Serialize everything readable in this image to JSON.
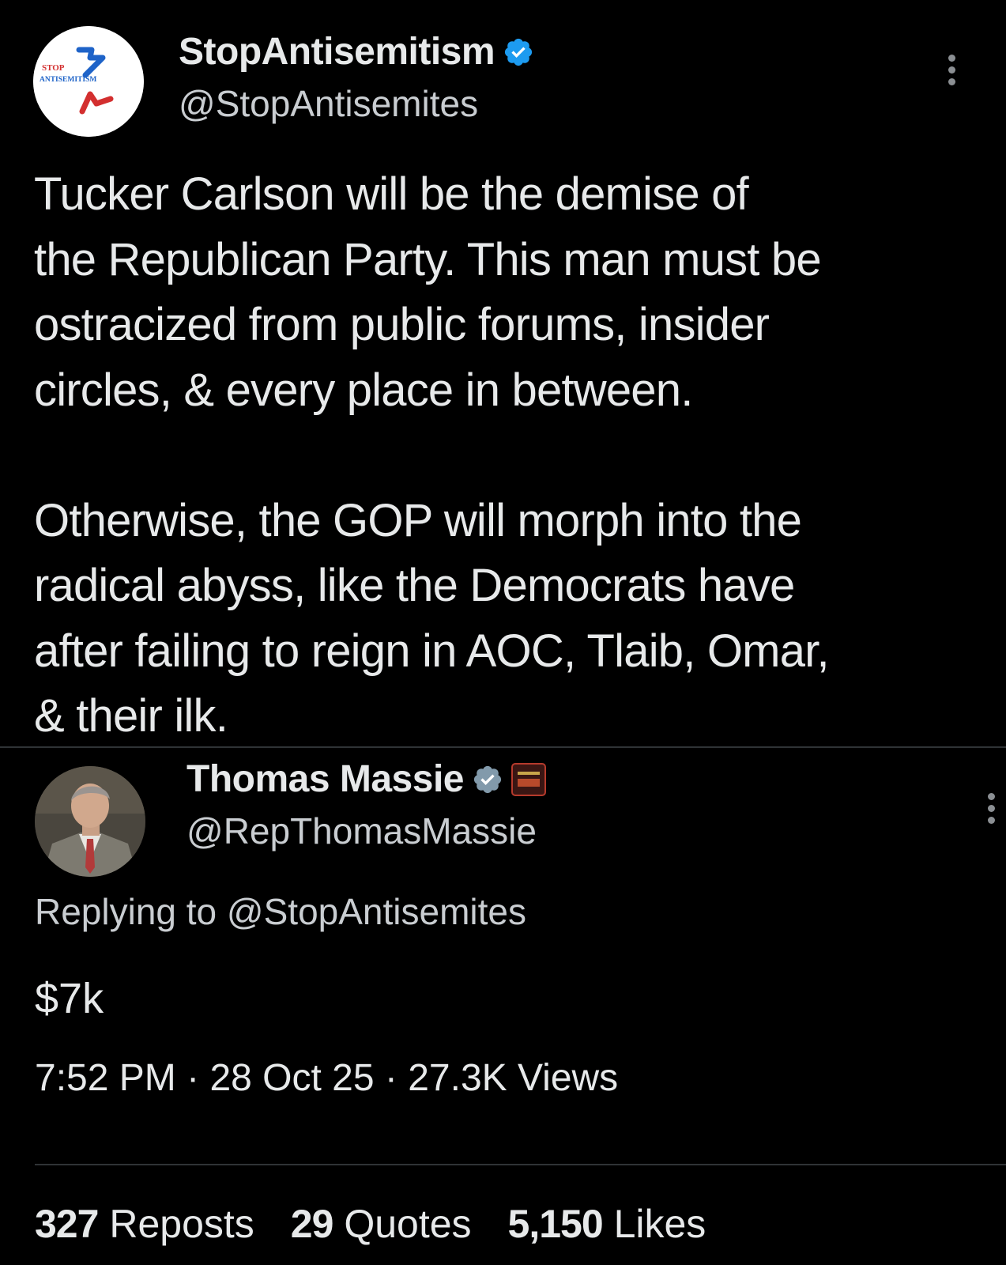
{
  "tweet": {
    "author": {
      "display_name": "StopAntisemitism",
      "handle": "@StopAntisemites",
      "verified": true,
      "avatar_logo_lines": [
        "STOP",
        "ANTISEMITISM"
      ]
    },
    "text": "Tucker Carlson will be the demise of\nthe Republican Party. This man must be\nostracized from public forums, insider\ncircles, & every place in between.\n\nOtherwise, the GOP will morph into the\nradical abyss, like the Democrats have\nafter failing to reign in AOC, Tlaib, Omar,\n& their ilk."
  },
  "reply": {
    "author": {
      "display_name": "Thomas Massie",
      "handle": "@RepThomasMassie",
      "verified": true
    },
    "replying_to_prefix": "Replying to ",
    "replying_to_handle": "@StopAntisemites",
    "text": "$7k",
    "time": "7:52 PM",
    "date": "28 Oct 25",
    "views": "27.3K Views",
    "separator": "·",
    "stats": {
      "reposts_count": "327",
      "reposts_label": "Reposts",
      "quotes_count": "29",
      "quotes_label": "Quotes",
      "likes_count": "5,150",
      "likes_label": "Likes"
    }
  },
  "colors": {
    "background": "#000000",
    "text_primary": "#e7e9ea",
    "text_secondary": "#c9cdd1",
    "verified_blue": "#1d9bf0",
    "verified_gray": "#829aab",
    "logo_blue": "#1e63c8",
    "logo_red": "#d32f2f"
  }
}
